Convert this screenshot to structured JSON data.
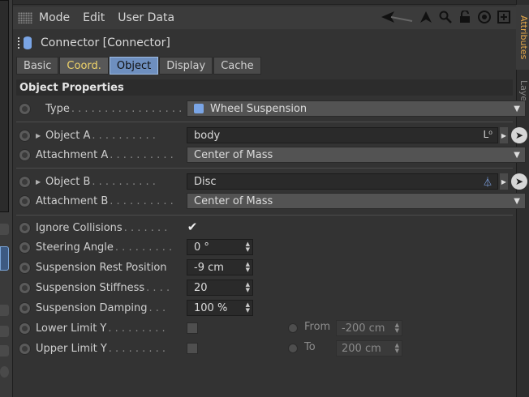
{
  "menu": {
    "items": [
      "Mode",
      "Edit",
      "User Data"
    ],
    "icons": [
      "back-arrow-icon",
      "up-arrow-icon",
      "search-icon",
      "lock-icon",
      "target-icon",
      "new-window-icon"
    ]
  },
  "side_tabs": {
    "active": "Attributes",
    "inactive": "Layers"
  },
  "object": {
    "title": "Connector [Connector]"
  },
  "tabs": [
    {
      "label": "Basic"
    },
    {
      "label": "Coord."
    },
    {
      "label": "Object"
    },
    {
      "label": "Display"
    },
    {
      "label": "Cache"
    }
  ],
  "section_title": "Object Properties",
  "fields": {
    "type": {
      "label": "Type",
      "value": "Wheel Suspension"
    },
    "object_a": {
      "label": "Object A",
      "value": "body"
    },
    "attachment_a": {
      "label": "Attachment A",
      "value": "Center of Mass"
    },
    "object_b": {
      "label": "Object B",
      "value": "Disc"
    },
    "attachment_b": {
      "label": "Attachment B",
      "value": "Center of Mass"
    },
    "ignore_collisions": {
      "label": "Ignore Collisions",
      "checked": true,
      "mark": "✔"
    },
    "steering_angle": {
      "label": "Steering Angle",
      "value": "0 °"
    },
    "suspension_rest_position": {
      "label": "Suspension Rest Position",
      "value": "-9 cm"
    },
    "suspension_stiffness": {
      "label": "Suspension Stiffness",
      "value": "20"
    },
    "suspension_damping": {
      "label": "Suspension Damping",
      "value": "100 %"
    },
    "lower_limit_y": {
      "label": "Lower Limit Y",
      "checked": false,
      "sub_label": "From",
      "sub_value": "-200 cm"
    },
    "upper_limit_y": {
      "label": "Upper Limit Y",
      "checked": false,
      "sub_label": "To",
      "sub_value": "200 cm"
    }
  }
}
